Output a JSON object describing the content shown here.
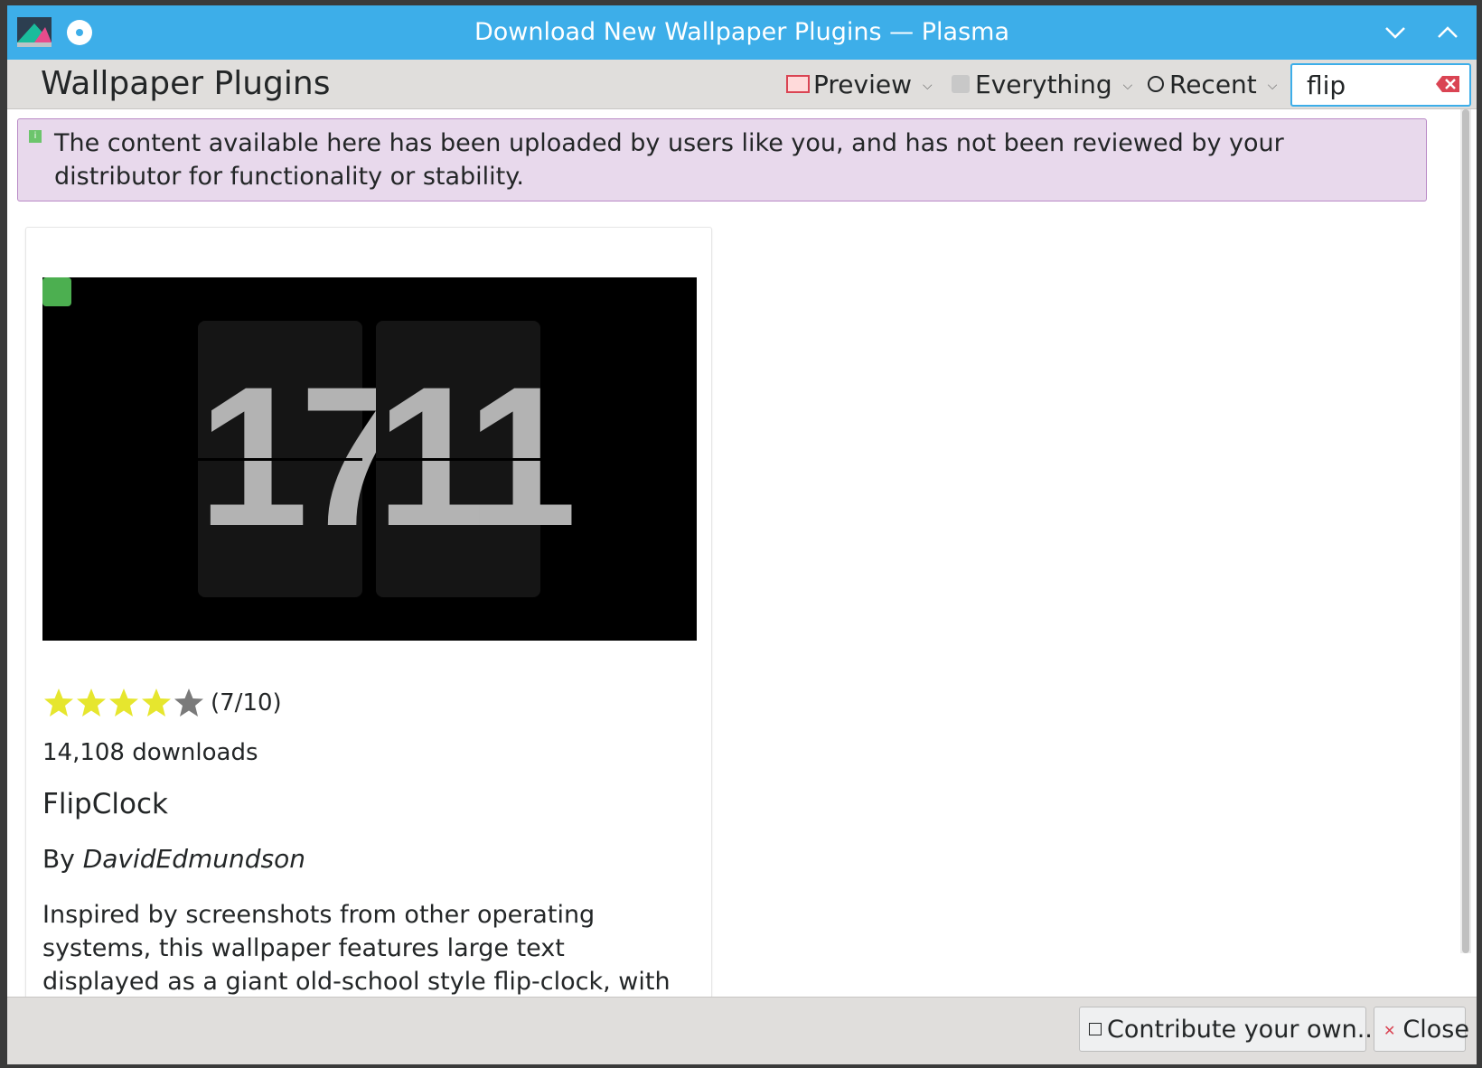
{
  "window": {
    "title": "Download New Wallpaper Plugins — Plasma"
  },
  "header": {
    "title": "Wallpaper Plugins",
    "view_mode": "Preview",
    "filter": "Everything",
    "sort": "Recent",
    "search_value": "flip",
    "search_placeholder": ""
  },
  "notice": {
    "text": "The content available here has been uploaded by users like you, and has not been reviewed by your distributor for functionality or stability."
  },
  "item": {
    "preview_digits_left": "17",
    "preview_digits_right": "11",
    "rating_text": "(7/10)",
    "rating_stars_filled": 4,
    "rating_stars_total": 5,
    "downloads": "14,108 downloads",
    "name": "FlipClock",
    "author_prefix": "By ",
    "author": "DavidEdmundson",
    "description": "Inspired by screenshots from other operating systems, this wallpaper features large text displayed as a giant old-school style flip-clock, with appropriate animations."
  },
  "footer": {
    "contribute_label": "Contribute your own...",
    "close_label": "Close"
  },
  "colors": {
    "titlebar": "#3daee9",
    "notice_bg": "#e8d9ec",
    "star_filled": "#e6e62e",
    "star_empty": "#7a7a7a",
    "installed_badge": "#4caf50"
  },
  "icons": {
    "app": "discover-icon",
    "pin": "pin-icon",
    "minimize": "chevron-down-icon",
    "maximize": "chevron-up-icon",
    "preview": "image-icon",
    "everything": "filter-icon",
    "recent": "clock-icon",
    "clear": "clear-icon",
    "info": "info-icon",
    "contribute": "upload-icon",
    "close": "close-icon"
  }
}
